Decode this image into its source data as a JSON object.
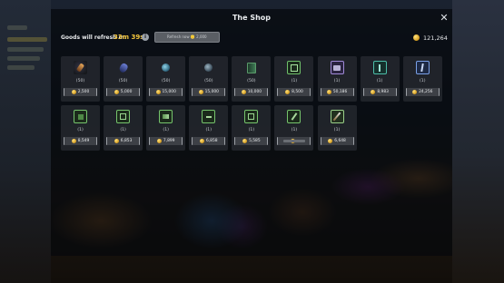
{
  "title": "The Shop",
  "refresh": {
    "label": "Goods will refresh in:",
    "time": "33m 39s",
    "info_icon": "info-icon",
    "button_label": "Refresh now 🪙 2,000"
  },
  "currency": {
    "icon": "gold-coin-icon",
    "amount": "121,264"
  },
  "colors": {
    "accent": "#f2c53d",
    "panel": "#22262c",
    "price_bg": "#3d4046"
  },
  "items": [
    {
      "icon": "rune-stone-icon",
      "style": "ic-rune",
      "qty": "(50)",
      "price": "2,500"
    },
    {
      "icon": "dark-crystal-icon",
      "style": "ic-gem-blue",
      "qty": "(50)",
      "price": "5,000"
    },
    {
      "icon": "mana-orb-icon",
      "style": "ic-orb",
      "qty": "(50)",
      "price": "15,000"
    },
    {
      "icon": "stone-orb-icon",
      "style": "ic-orb-grey",
      "qty": "(50)",
      "price": "15,000"
    },
    {
      "icon": "spellbook-icon",
      "style": "ic-book",
      "qty": "(50)",
      "price": "10,000"
    },
    {
      "icon": "green-scroll-icon",
      "style": "ic-frame-green",
      "qty": "(1)",
      "price": "8,500"
    },
    {
      "icon": "purple-tablet-icon",
      "style": "ic-frame-purple",
      "qty": "(1)",
      "price": "50,186"
    },
    {
      "icon": "teal-wand-icon",
      "style": "ic-frame-teal",
      "qty": "(1)",
      "price": "8,983"
    },
    {
      "icon": "blue-staff-icon",
      "style": "ic-frame-blue",
      "qty": "(1)",
      "price": "24,256"
    },
    {
      "icon": "green-chest-icon",
      "style": "ic-sq-green",
      "qty": "(1)",
      "price": "8,549"
    },
    {
      "icon": "green-box-icon",
      "style": "ic-sq-green2",
      "qty": "(1)",
      "price": "6,853"
    },
    {
      "icon": "green-bow-icon",
      "style": "ic-sq-green3",
      "qty": "(1)",
      "price": "7,899"
    },
    {
      "icon": "green-plate-icon",
      "style": "ic-sq-green4",
      "qty": "(1)",
      "price": "6,858"
    },
    {
      "icon": "green-gem-icon",
      "style": "ic-sq-green2",
      "qty": "(1)",
      "price": "5,585"
    },
    {
      "icon": "green-dagger-icon",
      "style": "ic-diag",
      "qty": "(1)",
      "price": "",
      "price_blurred": true
    },
    {
      "icon": "green-sword-icon",
      "style": "ic-sword",
      "qty": "(1)",
      "price": "6,648"
    }
  ]
}
